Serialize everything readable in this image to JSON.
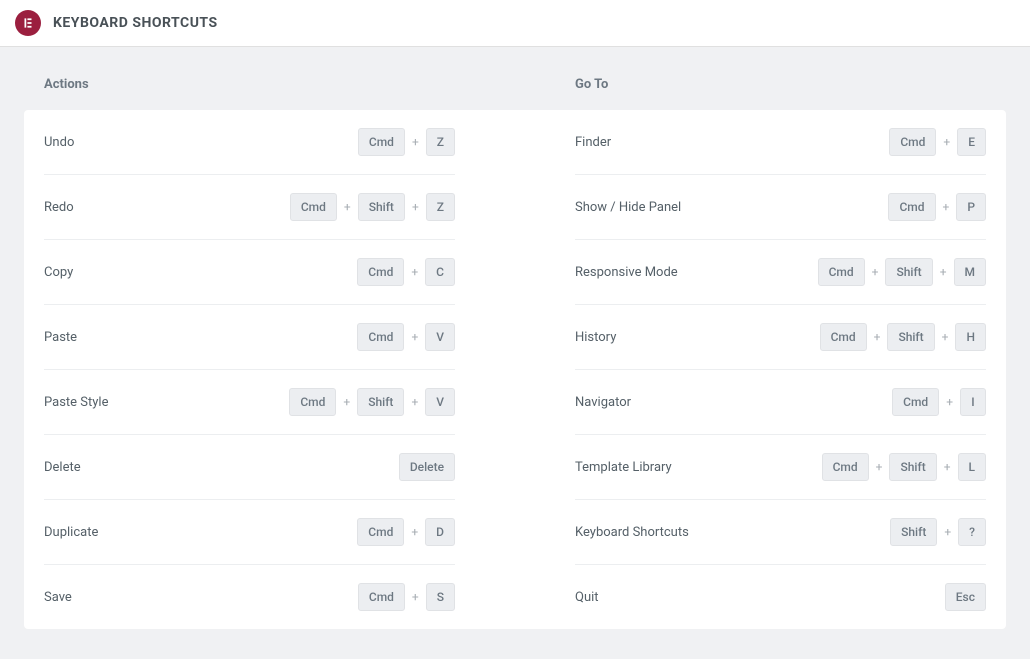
{
  "header": {
    "title": "KEYBOARD SHORTCUTS"
  },
  "sections": {
    "actions": {
      "title": "Actions",
      "rows": [
        {
          "label": "Undo",
          "keys": [
            "Cmd",
            "Z"
          ]
        },
        {
          "label": "Redo",
          "keys": [
            "Cmd",
            "Shift",
            "Z"
          ]
        },
        {
          "label": "Copy",
          "keys": [
            "Cmd",
            "C"
          ]
        },
        {
          "label": "Paste",
          "keys": [
            "Cmd",
            "V"
          ]
        },
        {
          "label": "Paste Style",
          "keys": [
            "Cmd",
            "Shift",
            "V"
          ]
        },
        {
          "label": "Delete",
          "keys": [
            "Delete"
          ]
        },
        {
          "label": "Duplicate",
          "keys": [
            "Cmd",
            "D"
          ]
        },
        {
          "label": "Save",
          "keys": [
            "Cmd",
            "S"
          ]
        }
      ]
    },
    "goto": {
      "title": "Go To",
      "rows": [
        {
          "label": "Finder",
          "keys": [
            "Cmd",
            "E"
          ]
        },
        {
          "label": "Show / Hide Panel",
          "keys": [
            "Cmd",
            "P"
          ]
        },
        {
          "label": "Responsive Mode",
          "keys": [
            "Cmd",
            "Shift",
            "M"
          ]
        },
        {
          "label": "History",
          "keys": [
            "Cmd",
            "Shift",
            "H"
          ]
        },
        {
          "label": "Navigator",
          "keys": [
            "Cmd",
            "I"
          ]
        },
        {
          "label": "Template Library",
          "keys": [
            "Cmd",
            "Shift",
            "L"
          ]
        },
        {
          "label": "Keyboard Shortcuts",
          "keys": [
            "Shift",
            "?"
          ]
        },
        {
          "label": "Quit",
          "keys": [
            "Esc"
          ]
        }
      ]
    }
  },
  "plus_symbol": "+"
}
